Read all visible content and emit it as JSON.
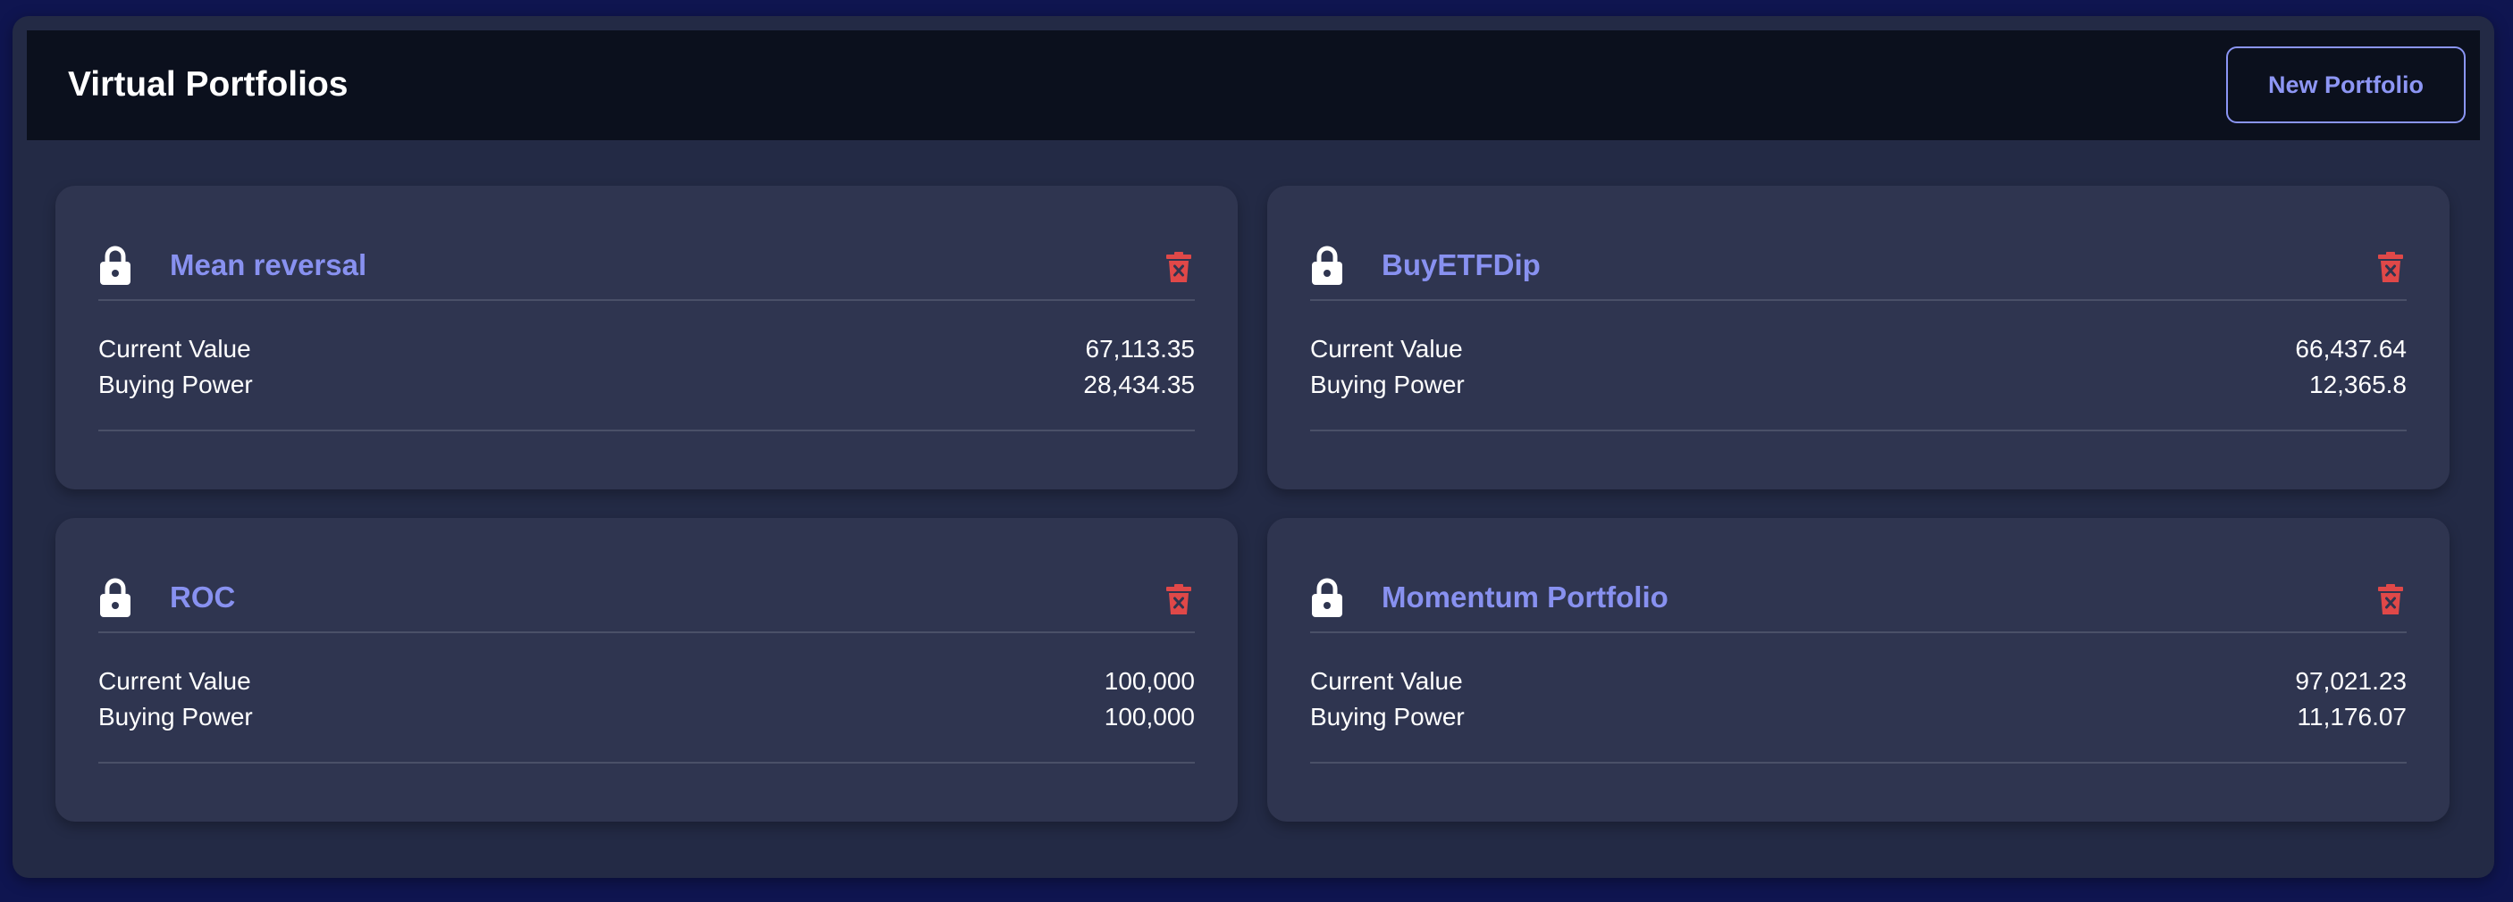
{
  "header": {
    "title": "Virtual Portfolios",
    "new_portfolio_label": "New Portfolio"
  },
  "labels": {
    "current_value": "Current Value",
    "buying_power": "Buying Power"
  },
  "portfolios": [
    {
      "name": "Mean reversal",
      "current_value": "67,113.35",
      "buying_power": "28,434.35",
      "icon": "lock-icon"
    },
    {
      "name": "BuyETFDip",
      "current_value": "66,437.64",
      "buying_power": "12,365.8",
      "icon": "lock-icon"
    },
    {
      "name": "ROC",
      "current_value": "100,000",
      "buying_power": "100,000",
      "icon": "lock-icon"
    },
    {
      "name": "Momentum Portfolio",
      "current_value": "97,021.23",
      "buying_power": "11,176.07",
      "icon": "lock-icon"
    }
  ],
  "colors": {
    "page_background": "#0f1550",
    "panel": "#232a45",
    "header_bar": "#0b101d",
    "card": "#2f3550",
    "accent": "#8891f0",
    "delete": "#e04848",
    "text": "#ffffff"
  }
}
